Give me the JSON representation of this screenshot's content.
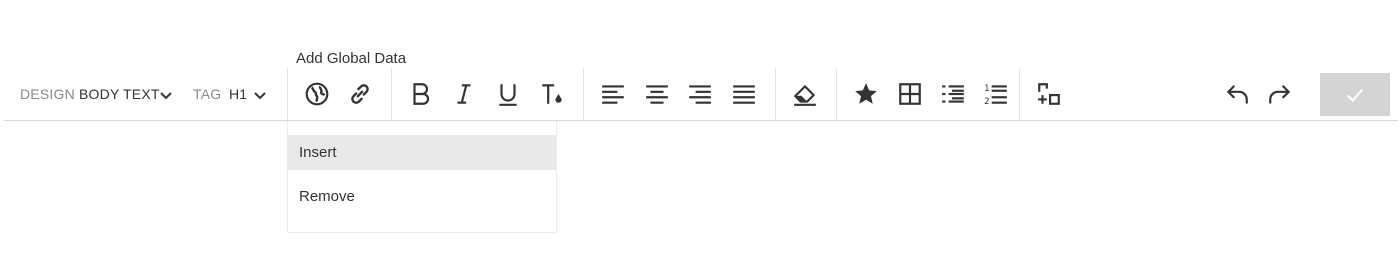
{
  "tooltip": "Add Global Data",
  "design": {
    "label": "DESIGN",
    "value": "BODY TEXT"
  },
  "tag": {
    "label": "TAG",
    "value": "H1"
  },
  "icons": [
    "globe-icon",
    "link-icon",
    "bold-icon",
    "italic-icon",
    "underline-icon",
    "text-color-icon",
    "align-left-icon",
    "align-center-icon",
    "align-right-icon",
    "align-justify-icon",
    "eraser-icon",
    "star-icon",
    "table-icon",
    "bulleted-list-icon",
    "numbered-list-icon",
    "insert-element-icon",
    "undo-icon",
    "redo-icon",
    "check-icon"
  ],
  "dropdown": {
    "items": [
      {
        "label": "Insert",
        "active": true
      },
      {
        "label": "Remove",
        "active": false
      }
    ]
  },
  "colors": {
    "confirm_bg": "#d4d4d4",
    "icon": "#333333",
    "active_item": "#e9e9e9"
  }
}
